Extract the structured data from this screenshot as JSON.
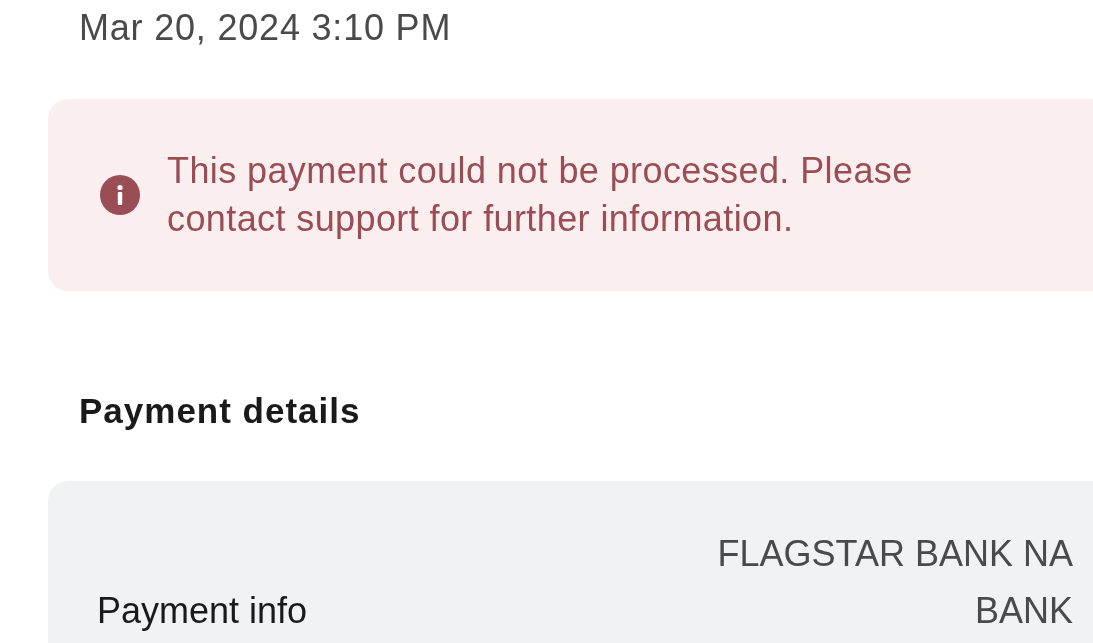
{
  "date": "Mar 20, 2024 3:10 PM",
  "alert": {
    "message": "This payment could not be processed. Please contact support for further information."
  },
  "payment_details": {
    "title": "Payment details",
    "rows": [
      {
        "label": "Payment info",
        "value": "FLAGSTAR BANK NA BANK"
      }
    ]
  }
}
